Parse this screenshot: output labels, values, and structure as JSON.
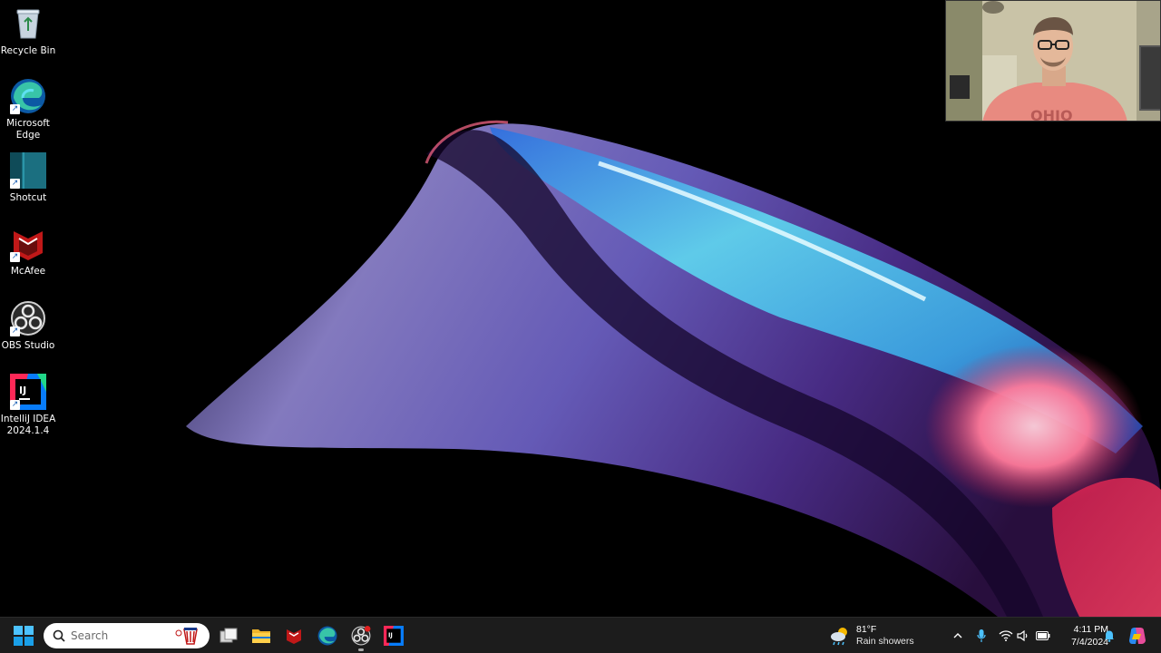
{
  "desktop": {
    "icons": [
      {
        "label": "Recycle Bin",
        "icon": "recycle-bin-icon"
      },
      {
        "label": "Microsoft Edge",
        "icon": "edge-icon"
      },
      {
        "label": "Shotcut",
        "icon": "shotcut-icon"
      },
      {
        "label": "McAfee",
        "icon": "mcafee-icon"
      },
      {
        "label": "OBS Studio",
        "icon": "obs-icon"
      },
      {
        "label": "IntelliJ IDEA 2024.1.4",
        "icon": "intellij-icon"
      }
    ]
  },
  "webcam": {
    "shirt_text": "OHIO"
  },
  "taskbar": {
    "search": {
      "placeholder": "Search"
    },
    "pinned": [
      "start-icon",
      "task-view-icon",
      "file-explorer-icon",
      "mcafee-icon",
      "edge-icon",
      "obs-icon",
      "intellij-icon"
    ],
    "weather": {
      "temperature": "81°F",
      "condition": "Rain showers"
    },
    "clock": {
      "time": "4:11 PM",
      "date": "7/4/2024"
    }
  },
  "colors": {
    "taskbar_bg": "#1c1c1c",
    "accent_blue": "#0078d4",
    "mcafee_red": "#c01818",
    "shotcut_teal": "#1b6f80"
  }
}
